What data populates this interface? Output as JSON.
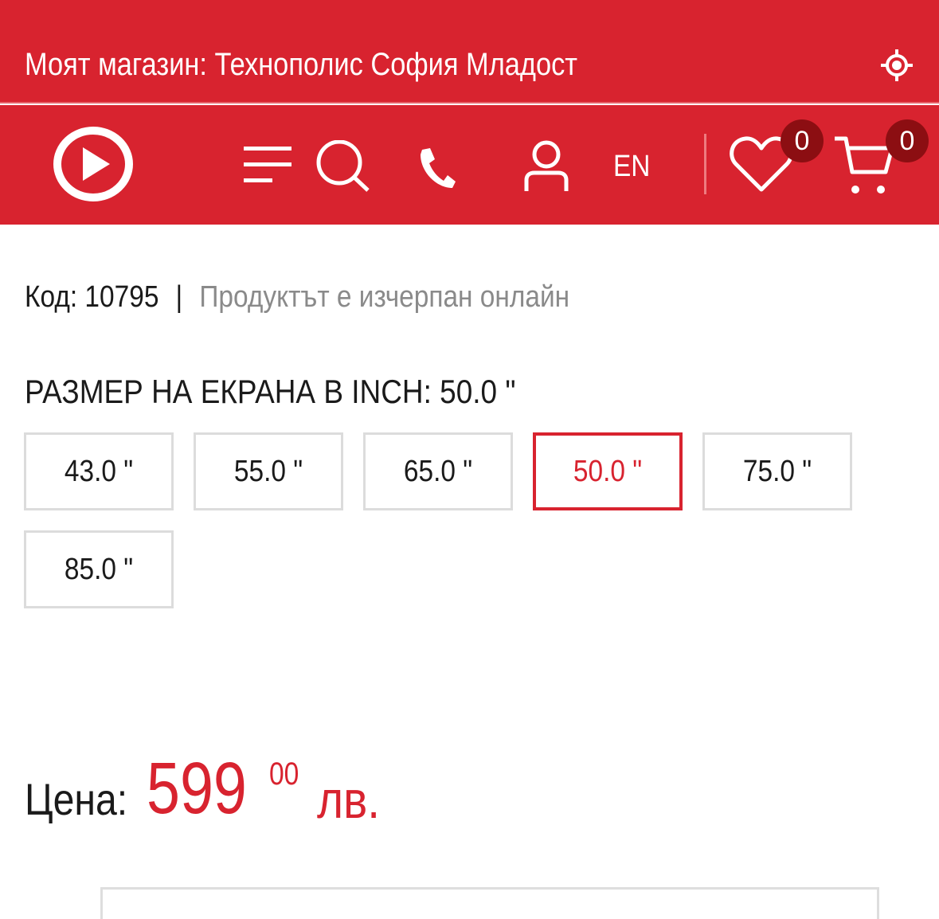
{
  "store_bar": {
    "text": "Моят магазин: Технополис София Младост",
    "locate_icon": "crosshair-icon"
  },
  "nav": {
    "logo_icon": "play-logo-icon",
    "menu_icon": "menu-icon",
    "search_icon": "search-icon",
    "phone_icon": "phone-icon",
    "user_icon": "user-icon",
    "language": "EN",
    "wishlist_icon": "heart-icon",
    "wishlist_count": "0",
    "cart_icon": "cart-icon",
    "cart_count": "0"
  },
  "product": {
    "code": "Код: 10795",
    "separator": "|",
    "stock_status": "Продуктът е изчерпан онлайн"
  },
  "size_selector": {
    "title": "РАЗМЕР НА ЕКРАНА В INCH: 50.0 \"",
    "options": [
      "43.0 \"",
      "55.0 \"",
      "65.0 \"",
      "50.0 \"",
      "75.0 \"",
      "85.0 \""
    ],
    "selected": "50.0 \""
  },
  "price": {
    "label": "Цена:",
    "whole": "599",
    "cents": "00",
    "currency": "лв."
  },
  "colors": {
    "brand_red": "#d8232f",
    "badge_dark_red": "#8c0e12",
    "muted_text": "#8a8a8a",
    "border_gray": "#dcdcdc"
  }
}
